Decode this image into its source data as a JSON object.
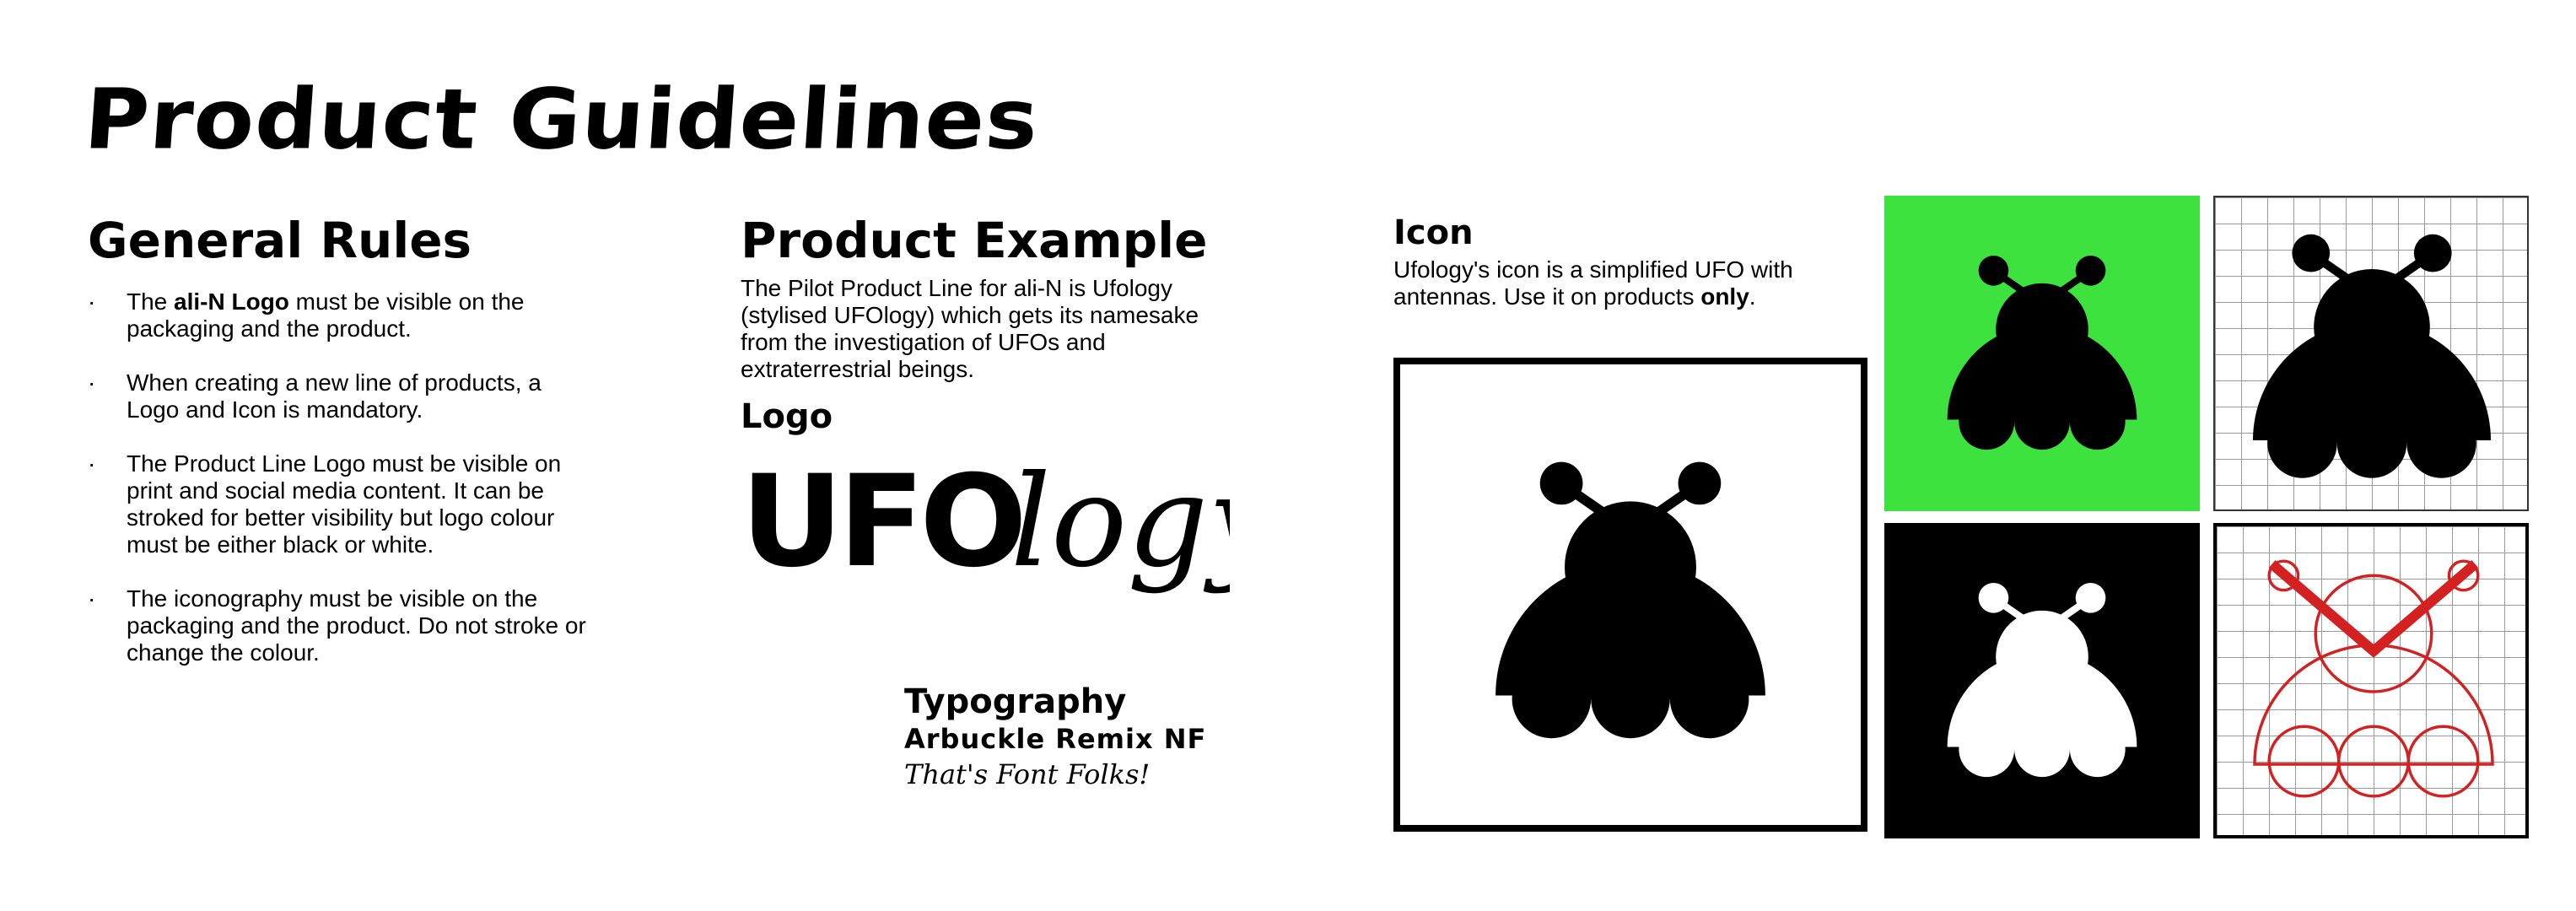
{
  "page": {
    "title": "Product Guidelines"
  },
  "general_rules": {
    "heading": "General Rules",
    "bullet": "·",
    "items": [
      {
        "pre": "The ",
        "bold": "ali-N Logo",
        "post": " must be visible on the packaging and the product."
      },
      {
        "pre": "When creating a new line of products, a Logo and Icon is mandatory.",
        "bold": "",
        "post": ""
      },
      {
        "pre": "The Product Line Logo must be visible on print and social media content. It can be stroked for better visibility but logo colour must be either black or white.",
        "bold": "",
        "post": ""
      },
      {
        "pre": "The iconography must be visible on the packaging and the product. Do not stroke or change the colour.",
        "bold": "",
        "post": ""
      }
    ]
  },
  "product_example": {
    "heading": "Product Example",
    "description": "The Pilot Product Line for ali-N is Ufology (stylised UFOlogy) which gets its namesake from the investigation of UFOs and extraterrestrial beings.",
    "logo_heading": "Logo",
    "logo_word_bold": "UFO",
    "logo_word_script": "logy",
    "typography_heading": "Typography",
    "typography_font": "Arbuckle Remix NF",
    "typography_sample": "That's Font Folks!"
  },
  "icon_section": {
    "heading": "Icon",
    "description_pre": "Ufology's icon is a simplified UFO with antennas. Use it on products ",
    "description_bold": "only",
    "description_post": "."
  },
  "colors": {
    "green_tile": "#3ee23e",
    "black_tile": "#000000",
    "construction_red": "#d32020",
    "grid_line": "#9a9a9a"
  }
}
